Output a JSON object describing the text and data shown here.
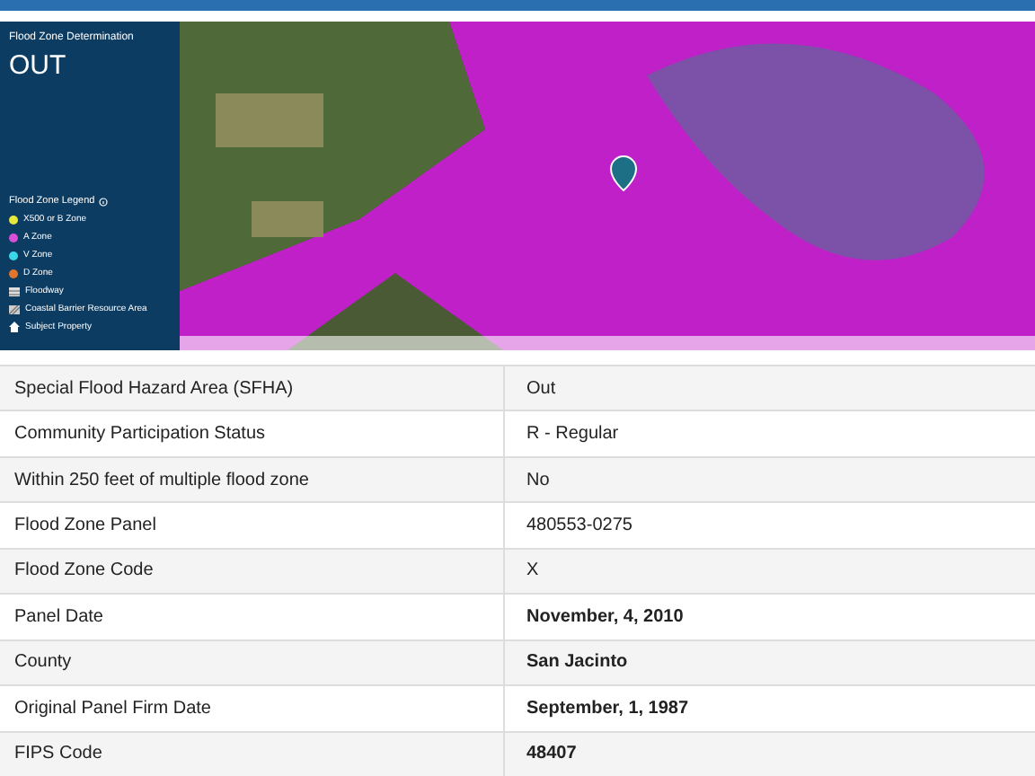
{
  "determination": {
    "title": "Flood Zone Determination",
    "value": "OUT"
  },
  "legend": {
    "title": "Flood Zone Legend",
    "items": [
      {
        "kind": "dot",
        "label": "X500 or B Zone",
        "color": "#e8e83a"
      },
      {
        "kind": "dot",
        "label": "A Zone",
        "color": "#d84fd8"
      },
      {
        "kind": "dot",
        "label": "V Zone",
        "color": "#3ad8e8"
      },
      {
        "kind": "dot",
        "label": "D Zone",
        "color": "#e0752c"
      },
      {
        "kind": "floodway",
        "label": "Floodway"
      },
      {
        "kind": "cbra",
        "label": "Coastal Barrier Resource Area"
      },
      {
        "kind": "property",
        "label": "Subject Property"
      }
    ]
  },
  "rows": [
    {
      "label": "Special Flood Hazard Area (SFHA)",
      "value": "Out",
      "bold": false
    },
    {
      "label": "Community Participation Status",
      "value": "R - Regular",
      "bold": false
    },
    {
      "label": "Within 250 feet of multiple flood zone",
      "value": "No",
      "bold": false
    },
    {
      "label": "Flood Zone Panel",
      "value": "480553-0275",
      "bold": false
    },
    {
      "label": "Flood Zone Code",
      "value": "X",
      "bold": false
    },
    {
      "label": "Panel Date",
      "value": "November, 4, 2010",
      "bold": true
    },
    {
      "label": "County",
      "value": "San Jacinto",
      "bold": true
    },
    {
      "label": "Original Panel Firm Date",
      "value": "September, 1, 1987",
      "bold": true
    },
    {
      "label": "FIPS Code",
      "value": "48407",
      "bold": true
    }
  ]
}
